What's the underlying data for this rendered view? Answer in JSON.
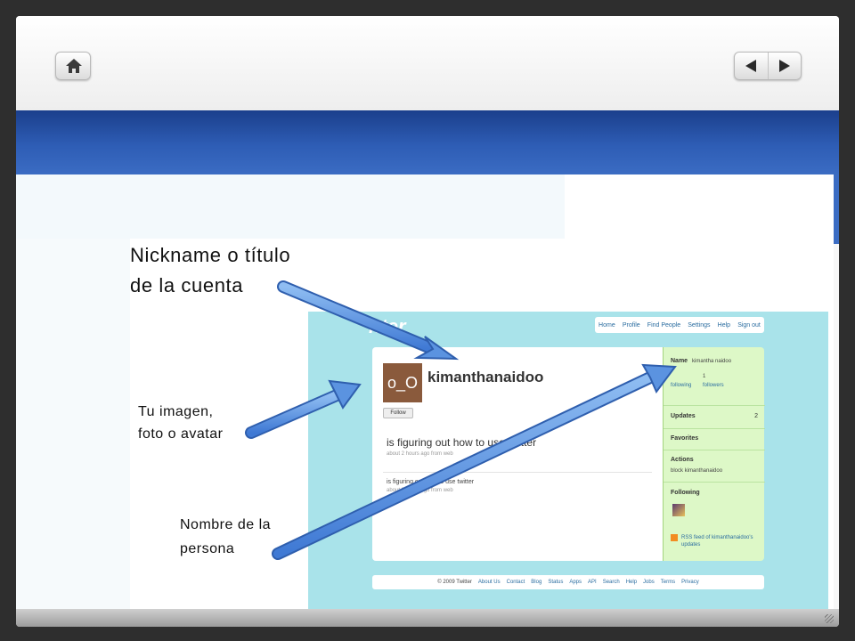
{
  "annotations": {
    "title_label": [
      "Nickname o título",
      "de la cuenta"
    ],
    "avatar_label": [
      "Tu imagen,",
      "foto o avatar"
    ],
    "name_label": [
      "Nombre de la",
      "persona"
    ]
  },
  "twitter": {
    "logo": "itter",
    "nav": [
      "Home",
      "Profile",
      "Find People",
      "Settings",
      "Help",
      "Sign out"
    ],
    "avatar_text": "o_O",
    "follow_label": "Follow",
    "username": "kimanthanaidoo",
    "tweet": "is figuring out how to use twitter",
    "tweet_meta": "about 2 hours ago from web",
    "tweet2": "is figuring out how to use twitter",
    "tweet2_meta": "about 2 hours ago from web",
    "sidebar": {
      "name_label": "Name",
      "name_value": "kimantha naidoo",
      "following_count": "1",
      "following_label": "following",
      "followers_label": "followers",
      "updates_label": "Updates",
      "updates_count": "2",
      "favorites_label": "Favorites",
      "actions_label": "Actions",
      "block_text": "block kimanthanaidoo",
      "following_heading": "Following",
      "rss_text": "RSS feed of kimanthanaidoo's updates"
    },
    "footer": [
      "© 2009 Twitter",
      "About Us",
      "Contact",
      "Blog",
      "Status",
      "Apps",
      "API",
      "Search",
      "Help",
      "Jobs",
      "Terms",
      "Privacy"
    ]
  },
  "colors": {
    "band": "#2e5db5",
    "arrow": "#5b93e0",
    "twitter_bg": "#a9e3ea",
    "sidebar_bg": "#ddf8c7"
  },
  "icons": {
    "home": "home-icon",
    "prev": "triangle-left-icon",
    "next": "triangle-right-icon"
  }
}
